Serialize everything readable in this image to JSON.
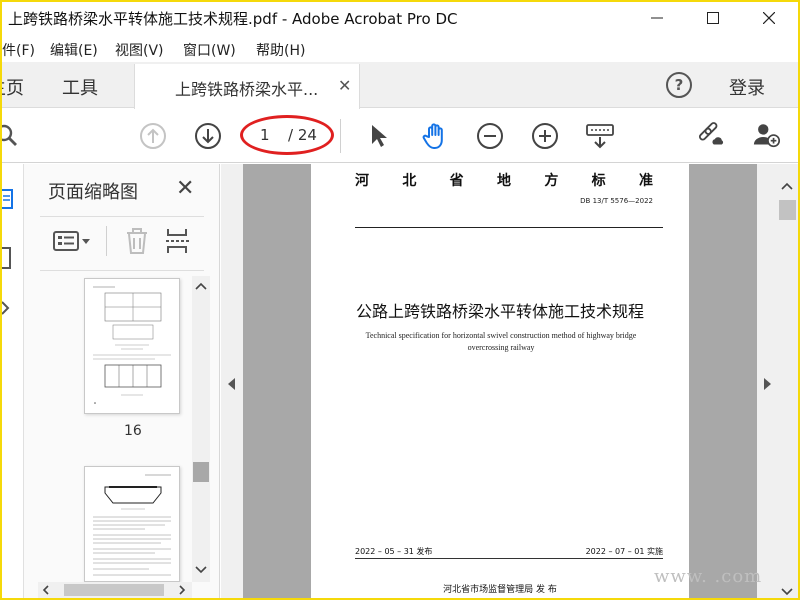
{
  "window": {
    "title": "上跨铁路桥梁水平转体施工技术规程.pdf - Adobe Acrobat Pro DC"
  },
  "menu": {
    "items": [
      "件(F)",
      "编辑(E)",
      "视图(V)",
      "窗口(W)",
      "帮助(H)"
    ]
  },
  "tabs": {
    "home": "主页",
    "tools": "工具",
    "document": "上跨铁路桥梁水平...",
    "login": "登录",
    "help": "?"
  },
  "toolbar": {
    "current_page": "1",
    "total_pages": "/ 24"
  },
  "thumbnails": {
    "title": "页面缩略图",
    "close": "✕",
    "page_number": "16"
  },
  "page": {
    "org_chars": [
      "河",
      "北",
      "省",
      "地",
      "方",
      "标",
      "准"
    ],
    "standard_no": "DB 13/T  5576—2022",
    "title": "公路上跨铁路桥梁水平转体施工技术规程",
    "title_en_1": "Technical specification for horizontal swivel construction method of highway bridge",
    "title_en_2": "overcrossing railway",
    "publish_date": "2022 – 05 – 31 发布",
    "implement_date": "2022 – 07 – 01 实施",
    "bureau": "河北省市场监督管理局    发  布"
  },
  "watermark": "www.     .com",
  "colors": {
    "frame": "#f5d90a",
    "accent": "#1473e6",
    "annotation": "#e02020"
  }
}
